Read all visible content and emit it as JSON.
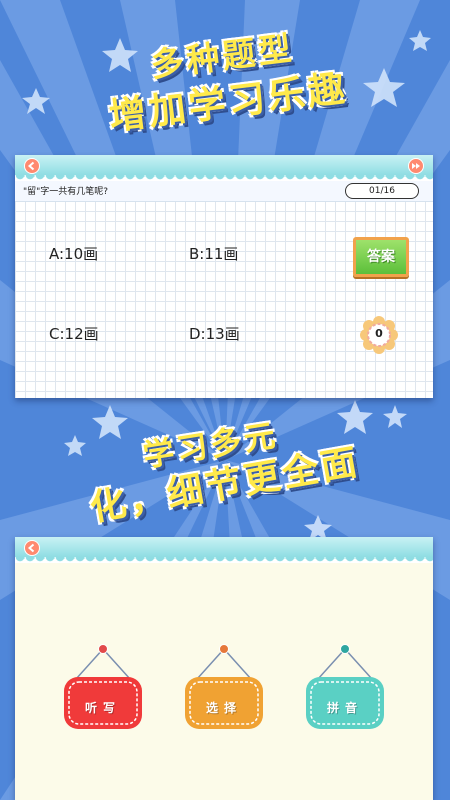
{
  "headlines": {
    "line1": "多种题型",
    "line2": "增加学习乐趣",
    "line3": "学习多元",
    "line4": "化，细节更全面"
  },
  "quiz": {
    "question": "\"留\"字一共有几笔呢?",
    "counter": "01/16",
    "options": {
      "a": "A:10画",
      "b": "B:11画",
      "c": "C:12画",
      "d": "D:13画"
    },
    "answer_button": "答案",
    "score": "0"
  },
  "modes": {
    "dictation": "听写",
    "choice": "选择",
    "pinyin": "拼音"
  },
  "colors": {
    "background": "#4f86d9",
    "ray": "#6b9be3",
    "headline": "#ffe94a",
    "panel_bar": "#8fdde3",
    "answer_green": "#5cbf3a",
    "dictation_red": "#f03a3a",
    "choice_orange": "#f0a233",
    "pinyin_teal": "#5ad0c4"
  },
  "icons": {
    "prev": "chevron-left-icon",
    "next": "fast-forward-icon",
    "score": "flower-badge-icon",
    "stars": "star-icon"
  }
}
